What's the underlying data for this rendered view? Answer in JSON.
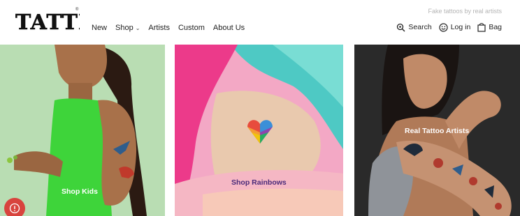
{
  "brand": {
    "logo_text": "TATTLY",
    "trademark": "®"
  },
  "tagline": "Fake tattoos by real artists",
  "nav": [
    {
      "label": "New"
    },
    {
      "label": "Shop",
      "has_dropdown": true
    },
    {
      "label": "Artists"
    },
    {
      "label": "Custom"
    },
    {
      "label": "About Us"
    }
  ],
  "utilities": {
    "search": "Search",
    "login": "Log in",
    "bag": "Bag"
  },
  "panels": [
    {
      "label": "Shop Kids"
    },
    {
      "label": "Shop Rainbows"
    },
    {
      "label": "Real Tattoo Artists"
    }
  ],
  "icons": {
    "search": "search-icon",
    "login": "smiley-icon",
    "bag": "bag-icon",
    "chevron": "chevron-down-icon",
    "help": "help-icon"
  },
  "colors": {
    "accent_help": "#d8443e",
    "rainbow_label": "#4a2a7a",
    "kids_bg": "#b9ddb3",
    "rainbow_bg": "#f3a8c5",
    "artists_bg": "#2a2a2a"
  }
}
